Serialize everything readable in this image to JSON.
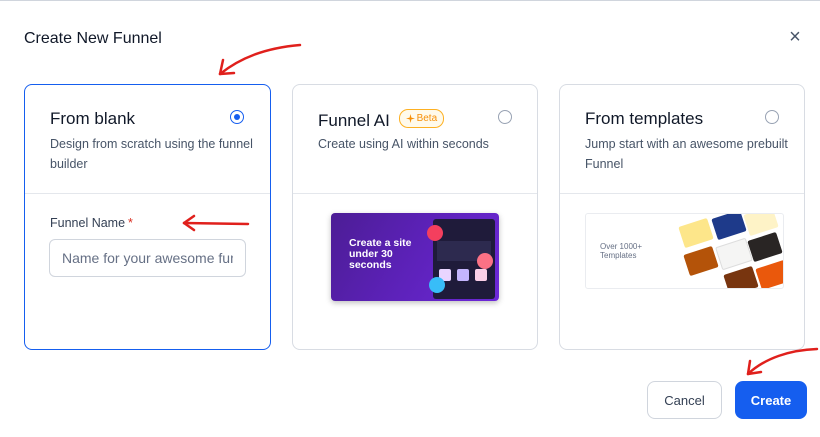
{
  "modal": {
    "title": "Create New Funnel",
    "close_glyph": "×"
  },
  "options": [
    {
      "title": "From blank",
      "description": "Design from scratch using the funnel builder",
      "selected": true
    },
    {
      "title": "Funnel AI",
      "badge": "Beta",
      "description": "Create using AI within seconds",
      "preview_text": "Create a site under 30 seconds",
      "selected": false
    },
    {
      "title": "From templates",
      "description": "Jump start with an awesome prebuilt Funnel",
      "preview_text": "Over 1000+ Templates",
      "selected": false
    }
  ],
  "form": {
    "funnel_name_label": "Funnel Name",
    "required_mark": "*",
    "funnel_name_placeholder": "Name for your awesome funnel",
    "funnel_name_value": ""
  },
  "footer": {
    "cancel_label": "Cancel",
    "create_label": "Create"
  },
  "colors": {
    "primary": "#155eef",
    "annotation_arrow": "#e0201c",
    "beta_badge": "#f79009"
  },
  "icons": [
    "close-icon",
    "radio-icon",
    "sparkle-icon",
    "annotation-arrow"
  ]
}
